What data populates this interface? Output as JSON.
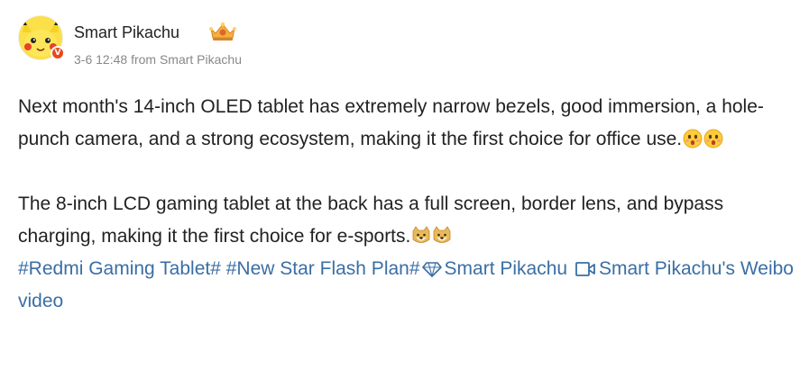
{
  "post": {
    "author": {
      "name": "Smart Pikachu",
      "avatar_icon": "pikachu-avatar",
      "verified_badge_label": "V",
      "level_icon": "crown-icon"
    },
    "meta": {
      "timestamp": "3-6 12:48",
      "source_prefix": "from",
      "source": "Smart Pikachu"
    },
    "paragraphs": [
      "Next month's 14-inch OLED tablet has extremely narrow bezels, good immersion, a hole-punch camera, and a strong ecosystem, making it the first choice for office use.",
      "The 8-inch LCD gaming tablet at the back has a full screen, border lens, and bypass charging, making it the first choice for e-sports."
    ],
    "paragraph_emojis": [
      [
        "astonished-face-emoji",
        "astonished-face-emoji"
      ],
      [
        "doge-emoji",
        "doge-emoji"
      ]
    ],
    "links": {
      "hashtag1": "#Redmi Gaming Tablet#",
      "hashtag2": "#New Star Flash Plan#",
      "hashtag2_icon": "diamond-icon",
      "author_link": "Smart Pikachu",
      "video_icon": "video-camera-icon",
      "video_link": "Smart Pikachu's Weibo video"
    },
    "colors": {
      "link": "#3a6ea5",
      "text": "#222222",
      "meta": "#888888",
      "verified_badge": "#e8491d"
    }
  }
}
